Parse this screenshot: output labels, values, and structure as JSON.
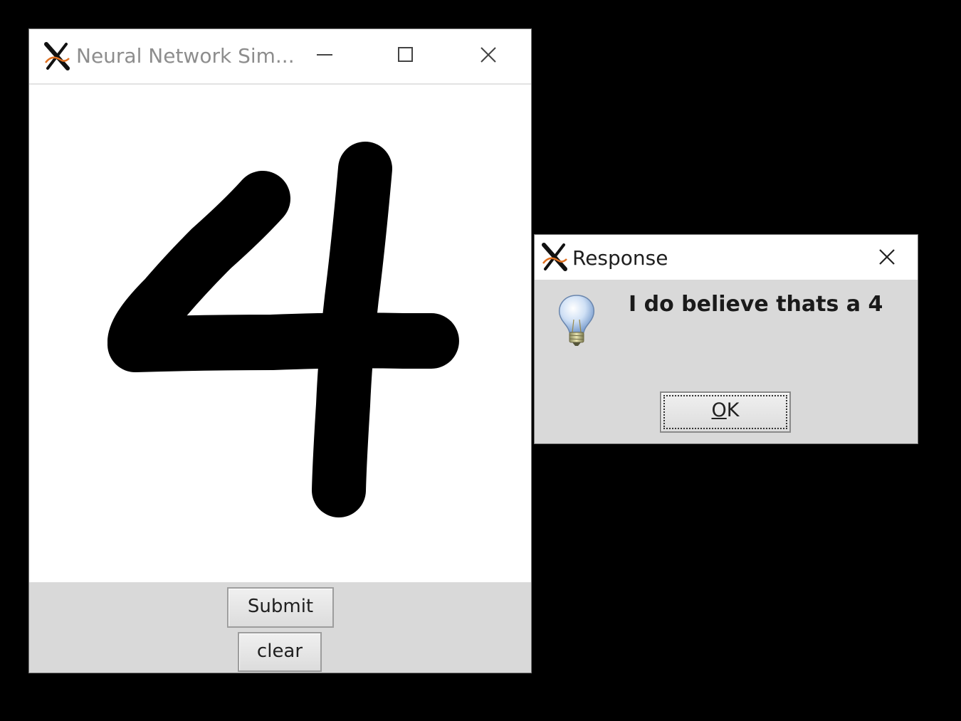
{
  "main_window": {
    "title": "Neural Network Sim...",
    "buttons": {
      "submit_label": "Submit",
      "clear_label": "clear"
    },
    "titlebar_icons": [
      "minimize-icon",
      "maximize-icon",
      "close-icon"
    ]
  },
  "dialog": {
    "title": "Response",
    "message": "I do believe thats a 4",
    "ok_mnemonic": "O",
    "ok_rest": "K",
    "icon": "lightbulb-icon"
  },
  "colors": {
    "desktop": "#000000",
    "panel": "#d9d9d9",
    "canvas": "#ffffff",
    "stroke": "#000000",
    "inactive_title": "#8d8d8d"
  }
}
